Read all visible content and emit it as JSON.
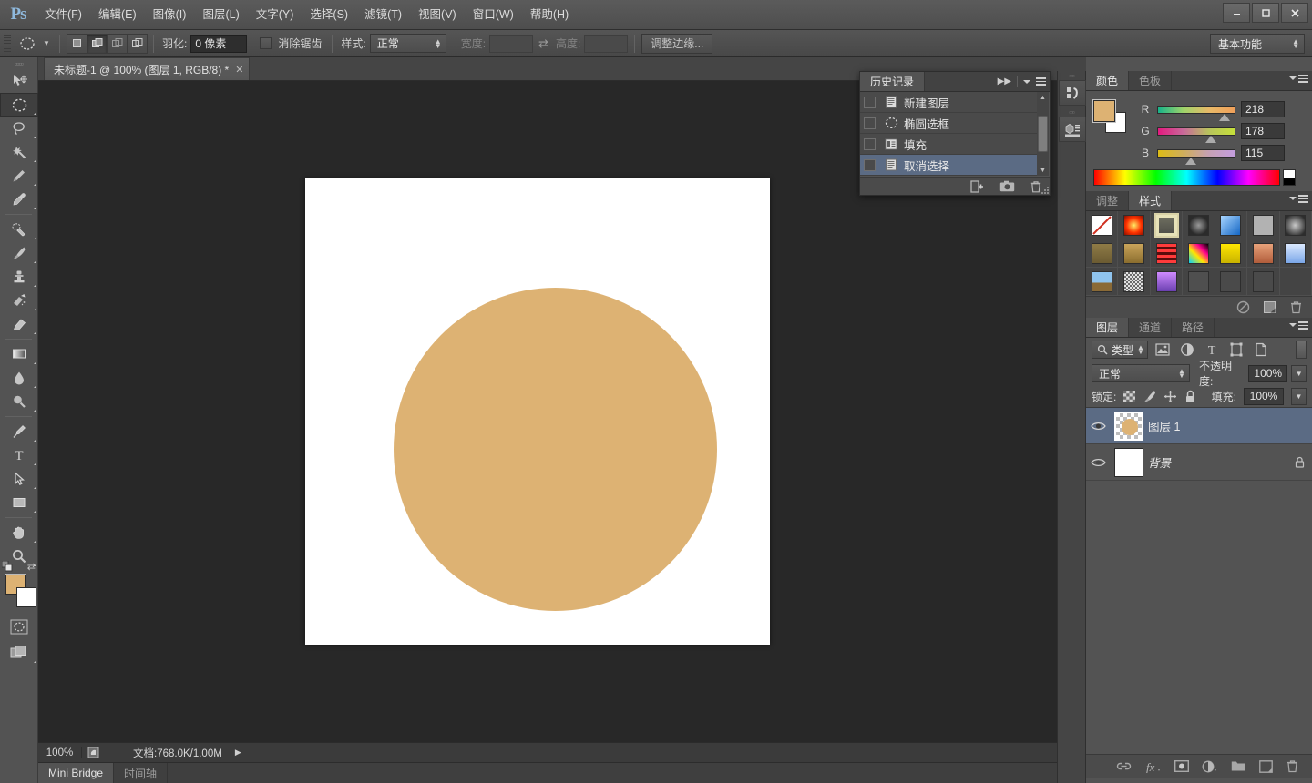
{
  "app": {
    "logo": "Ps",
    "accent_color": "#8fb9dd",
    "foreground_color": "#ddb273",
    "background_color": "#ffffff",
    "ui_bg": "#535353",
    "canvas_bg": "#282828",
    "selection_blue": "#5b6b84"
  },
  "menubar": {
    "items": [
      {
        "label": "文件(F)",
        "name": "menu-file"
      },
      {
        "label": "编辑(E)",
        "name": "menu-edit"
      },
      {
        "label": "图像(I)",
        "name": "menu-image"
      },
      {
        "label": "图层(L)",
        "name": "menu-layer"
      },
      {
        "label": "文字(Y)",
        "name": "menu-type"
      },
      {
        "label": "选择(S)",
        "name": "menu-select"
      },
      {
        "label": "滤镜(T)",
        "name": "menu-filter"
      },
      {
        "label": "视图(V)",
        "name": "menu-view"
      },
      {
        "label": "窗口(W)",
        "name": "menu-window"
      },
      {
        "label": "帮助(H)",
        "name": "menu-help"
      }
    ],
    "window_controls": {
      "minimize": "—",
      "maximize": "▣",
      "close": "✕"
    }
  },
  "options_bar": {
    "tool_icon": "elliptical-marquee-icon",
    "bool_modes": [
      "new-selection",
      "add-to-selection",
      "subtract-from-selection",
      "intersect-selection"
    ],
    "active_bool_mode_index": 1,
    "feather_label": "羽化:",
    "feather_value": "0 像素",
    "antialias_label": "消除锯齿",
    "antialias_checked": false,
    "style_label": "样式:",
    "style_value": "正常",
    "width_label": "宽度:",
    "width_value": "",
    "height_label": "高度:",
    "height_value": "",
    "swap_icon": "swap-dimensions-icon",
    "refine_edge_label": "调整边缘...",
    "workspace": "基本功能"
  },
  "toolbar": {
    "tools": [
      {
        "name": "move-tool",
        "label": "移动工具",
        "active": false,
        "hasMenu": false
      },
      {
        "name": "elliptical-marquee-tool",
        "label": "椭圆选框工具",
        "active": true,
        "hasMenu": true
      },
      {
        "name": "lasso-tool",
        "label": "套索工具",
        "active": false,
        "hasMenu": true
      },
      {
        "name": "magic-wand-tool",
        "label": "魔棒工具",
        "active": false,
        "hasMenu": true
      },
      {
        "name": "crop-tool",
        "label": "裁剪工具",
        "active": false,
        "hasMenu": true
      },
      {
        "name": "eyedropper-tool",
        "label": "吸管工具",
        "active": false,
        "hasMenu": true
      },
      {
        "name": "spot-healing-brush-tool",
        "label": "污点修复画笔工具",
        "active": false,
        "hasMenu": true
      },
      {
        "name": "brush-tool",
        "label": "画笔工具",
        "active": false,
        "hasMenu": true
      },
      {
        "name": "clone-stamp-tool",
        "label": "仿制图章工具",
        "active": false,
        "hasMenu": true
      },
      {
        "name": "history-brush-tool",
        "label": "历史记录画笔工具",
        "active": false,
        "hasMenu": true
      },
      {
        "name": "eraser-tool",
        "label": "橡皮擦工具",
        "active": false,
        "hasMenu": true
      },
      {
        "name": "gradient-tool",
        "label": "渐变工具",
        "active": false,
        "hasMenu": true
      },
      {
        "name": "blur-tool",
        "label": "模糊工具",
        "active": false,
        "hasMenu": true
      },
      {
        "name": "dodge-tool",
        "label": "减淡工具",
        "active": false,
        "hasMenu": true
      },
      {
        "name": "pen-tool",
        "label": "钢笔工具",
        "active": false,
        "hasMenu": true
      },
      {
        "name": "type-tool",
        "label": "横排文字工具",
        "active": false,
        "hasMenu": true
      },
      {
        "name": "path-selection-tool",
        "label": "路径选择工具",
        "active": false,
        "hasMenu": true
      },
      {
        "name": "rectangle-tool",
        "label": "矩形工具",
        "active": false,
        "hasMenu": true
      },
      {
        "name": "hand-tool",
        "label": "抓手工具",
        "active": false,
        "hasMenu": true
      },
      {
        "name": "zoom-tool",
        "label": "缩放工具",
        "active": false,
        "hasMenu": true
      }
    ],
    "quick_mask_label": "以快速蒙版模式编辑",
    "screen_mode_label": "更改屏幕模式"
  },
  "document": {
    "tab_title": "未标题-1 @ 100% (图层 1, RGB/8) *",
    "close_glyph": "✕",
    "canvas": {
      "background": "#ffffff",
      "shape": {
        "type": "circle",
        "fill": "#ddb273"
      }
    }
  },
  "status_bar": {
    "zoom": "100%",
    "doc_icon": "document-profile-icon",
    "doc_info": "文档:768.0K/1.00M",
    "expand_glyph": "▶"
  },
  "bottom_tabs": [
    {
      "label": "Mini Bridge",
      "name": "tab-mini-bridge",
      "active": true
    },
    {
      "label": "时间轴",
      "name": "tab-timeline",
      "active": false
    }
  ],
  "icon_dock": [
    {
      "name": "mini-bridge-dock-icon"
    },
    {
      "name": "3d-dock-icon"
    }
  ],
  "history_panel": {
    "tab_label": "历史记录",
    "collapse_glyph": "▶▶",
    "items": [
      {
        "label": "新建图层",
        "icon": "new-layer-icon",
        "selected": false
      },
      {
        "label": "椭圆选框",
        "icon": "elliptical-marquee-icon",
        "selected": false
      },
      {
        "label": "填充",
        "icon": "fill-icon",
        "selected": false
      },
      {
        "label": "取消选择",
        "icon": "deselect-icon",
        "selected": true
      }
    ],
    "footer_buttons": [
      {
        "name": "new-document-from-state-button"
      },
      {
        "name": "new-snapshot-button"
      },
      {
        "name": "delete-state-button"
      }
    ]
  },
  "color_panel": {
    "tabs": [
      {
        "label": "颜色",
        "name": "tab-color",
        "active": true
      },
      {
        "label": "色板",
        "name": "tab-swatches",
        "active": false
      }
    ],
    "foreground": "#ddb273",
    "background": "#ffffff",
    "channels": [
      {
        "letter": "R",
        "value": "218",
        "pct": 85
      },
      {
        "letter": "G",
        "value": "178",
        "pct": 70
      },
      {
        "letter": "B",
        "value": "115",
        "pct": 45
      }
    ]
  },
  "styles_panel": {
    "tabs": [
      {
        "label": "调整",
        "name": "tab-adjustments",
        "active": false
      },
      {
        "label": "样式",
        "name": "tab-styles",
        "active": true
      }
    ],
    "swatches": [
      {
        "name": "style-none",
        "css": "#ffffff",
        "selected": false,
        "slash": true
      },
      {
        "name": "style-red-glow",
        "css": "radial-gradient(circle,#ffee66 0%,#ff3300 55%,#8a0f00 100%)",
        "selected": false
      },
      {
        "name": "style-bevel-outline",
        "css": "linear-gradient(#6d6d5f,#51514a)",
        "selected": true
      },
      {
        "name": "style-dark-spiral",
        "css": "radial-gradient(circle,#8f8f8f 0%,#2b2b2b 70%)",
        "selected": false
      },
      {
        "name": "style-blue-sky",
        "css": "linear-gradient(135deg,#a9d6ff,#1466c4)",
        "selected": false
      },
      {
        "name": "style-gray-flat",
        "css": "#b2b2b2",
        "selected": false
      },
      {
        "name": "style-dark-vignette",
        "css": "radial-gradient(circle,#c9c9c9 0%,#2d2d2d 85%)",
        "selected": false
      },
      {
        "name": "style-olive",
        "css": "linear-gradient(#8f7b46,#6b5b32)",
        "selected": false
      },
      {
        "name": "style-gold",
        "css": "linear-gradient(#c9a45a,#8a6d2e)",
        "selected": false
      },
      {
        "name": "style-red-stripes",
        "css": "repeating-linear-gradient(#ff3b3b 0 3px,#5a0c0c 3px 6px)",
        "selected": false
      },
      {
        "name": "style-rainbow",
        "css": "linear-gradient(45deg,#00d4ff,#ffe600,#ff0090,#000)",
        "selected": false
      },
      {
        "name": "style-yellow-button",
        "css": "linear-gradient(#ffe600,#c8b200)",
        "selected": false
      },
      {
        "name": "style-sunset",
        "css": "linear-gradient(#e8a27a,#b05c3a)",
        "selected": false
      },
      {
        "name": "style-light-blue",
        "css": "linear-gradient(#dbe9ff,#7aa6e8)",
        "selected": false
      },
      {
        "name": "style-landscape",
        "css": "linear-gradient(#8fc4ef 55%,#8a6a36 55%)",
        "selected": false
      },
      {
        "name": "style-noise",
        "css": "repeating-conic-gradient(#e2e2e2 0 25%, #6b6b6b 0 50%)",
        "selected": false
      },
      {
        "name": "style-purple",
        "css": "linear-gradient(#d08bff,#6a3fb0)",
        "selected": false
      },
      {
        "name": "style-empty-1",
        "css": "#4f4f4f",
        "selected": false
      },
      {
        "name": "style-empty-2",
        "css": "#4a4a4a",
        "selected": false
      },
      {
        "name": "style-empty-3",
        "css": "#4a4a4a",
        "selected": false
      },
      {
        "name": "style-blank",
        "css": "transparent",
        "selected": false
      }
    ],
    "footer_buttons": [
      {
        "name": "clear-style-button"
      },
      {
        "name": "new-style-button"
      },
      {
        "name": "delete-style-button"
      }
    ]
  },
  "layers_panel": {
    "tabs": [
      {
        "label": "图层",
        "name": "tab-layers",
        "active": true
      },
      {
        "label": "通道",
        "name": "tab-channels",
        "active": false
      },
      {
        "label": "路径",
        "name": "tab-paths",
        "active": false
      }
    ],
    "filter_kind": "类型",
    "filter_icons": [
      "filter-pixel-icon",
      "filter-adjustment-icon",
      "filter-type-icon",
      "filter-shape-icon",
      "filter-smart-object-icon"
    ],
    "blend_mode": "正常",
    "opacity_label": "不透明度:",
    "opacity_value": "100%",
    "lock_label": "锁定:",
    "lock_icons": [
      "lock-transparent-pixels-icon",
      "lock-image-pixels-icon",
      "lock-position-icon",
      "lock-all-icon"
    ],
    "fill_label": "填充:",
    "fill_value": "100%",
    "layers": [
      {
        "name": "图层 1",
        "selected": true,
        "visible": true,
        "locked": false,
        "thumb": "circle-on-transparent",
        "italic": false
      },
      {
        "name": "背景",
        "selected": false,
        "visible": true,
        "locked": true,
        "thumb": "white",
        "italic": true
      }
    ],
    "footer_buttons": [
      {
        "name": "link-layers-button"
      },
      {
        "name": "layer-style-button",
        "label": "fx"
      },
      {
        "name": "add-layer-mask-button"
      },
      {
        "name": "new-fill-adjustment-layer-button"
      },
      {
        "name": "new-group-button"
      },
      {
        "name": "new-layer-button"
      },
      {
        "name": "delete-layer-button"
      }
    ]
  }
}
